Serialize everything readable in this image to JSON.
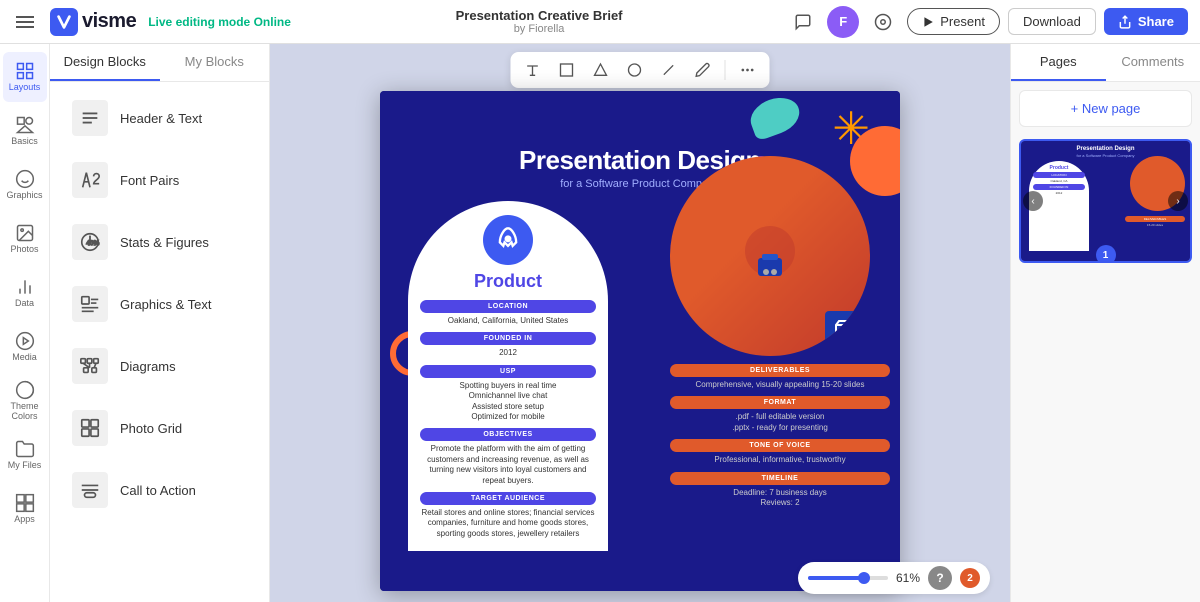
{
  "header": {
    "app_name": "visme",
    "editing_label": "Live editing mode",
    "editing_status": "Online",
    "presentation_title": "Presentation Creative Brief",
    "presentation_by": "by Fiorella",
    "present_label": "Present",
    "download_label": "Download",
    "share_label": "Share",
    "avatar_initial": "F"
  },
  "sidebar": {
    "items": [
      {
        "id": "layouts",
        "label": "Layouts",
        "icon": "grid"
      },
      {
        "id": "basics",
        "label": "Basics",
        "icon": "basics"
      },
      {
        "id": "graphics",
        "label": "Graphics",
        "icon": "graphics"
      },
      {
        "id": "photos",
        "label": "Photos",
        "icon": "photos"
      },
      {
        "id": "data",
        "label": "Data",
        "icon": "data"
      },
      {
        "id": "media",
        "label": "Media",
        "icon": "media"
      },
      {
        "id": "theme-colors",
        "label": "Theme Colors",
        "icon": "palette"
      },
      {
        "id": "my-files",
        "label": "My Files",
        "icon": "folder"
      },
      {
        "id": "apps",
        "label": "Apps",
        "icon": "apps"
      }
    ]
  },
  "design_panel": {
    "tab_design_blocks": "Design Blocks",
    "tab_my_blocks": "My Blocks",
    "items": [
      {
        "id": "header-text",
        "label": "Header & Text"
      },
      {
        "id": "font-pairs",
        "label": "Font Pairs"
      },
      {
        "id": "stats-figures",
        "label": "Stats & Figures"
      },
      {
        "id": "graphics-text",
        "label": "Graphics & Text"
      },
      {
        "id": "diagrams",
        "label": "Diagrams"
      },
      {
        "id": "photo-grid",
        "label": "Photo Grid"
      },
      {
        "id": "call-to-action",
        "label": "Call to Action"
      }
    ]
  },
  "canvas": {
    "slide": {
      "main_title": "Presentation Design",
      "subtitle": "for a Software Product Company",
      "product_label": "Product",
      "location_badge": "LOCATION",
      "location_value": "Oakland, California, United States",
      "founded_badge": "FOUNDED IN",
      "founded_value": "2012",
      "usp_badge": "USP",
      "usp_value": "Spotting buyers in real time\nOmnichannel live chat\nAssisted store setup\nOptimized for mobile",
      "objectives_badge": "OBJECTIVES",
      "objectives_value": "Promote the platform with the aim of getting customers and increasing revenue, as well as turning new visitors into loyal customers and repeat buyers.",
      "target_badge": "TARGET AUDIENCE",
      "target_value": "Retail stores and online stores; financial services companies, furniture and home goods stores, sporting goods stores, jewellery retailers",
      "deliverables_badge": "DELIVERABLES",
      "deliverables_value": "Comprehensive, visually appealing 15-20 slides",
      "format_badge": "FORMAT",
      "format_value": ".pdf - full editable version\n.pptx - ready for presenting",
      "tone_badge": "TONE OF VOICE",
      "tone_value": "Professional, informative, trustworthy",
      "timeline_badge": "TIMELINE",
      "timeline_value": "Deadline: 7 business days\nReviews: 2"
    }
  },
  "zoom": {
    "level": "61%",
    "help_label": "?",
    "notification_count": "2"
  },
  "pages_panel": {
    "tab_pages": "Pages",
    "tab_comments": "Comments",
    "new_page_label": "+ New page",
    "page_number": "1"
  }
}
